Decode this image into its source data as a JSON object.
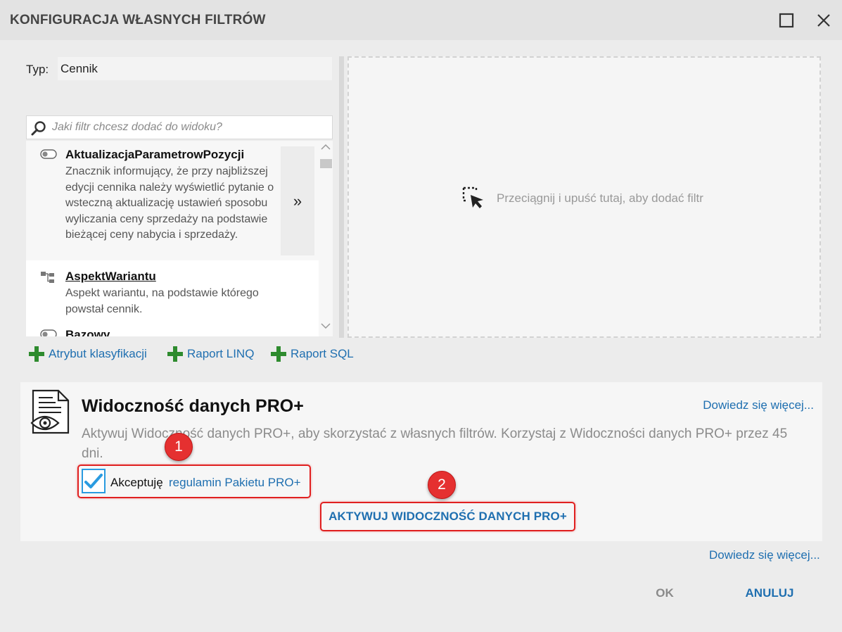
{
  "window": {
    "title": "KONFIGURACJA WŁASNYCH FILTRÓW",
    "maximize_icon": "maximize-icon",
    "close_icon": "close-icon"
  },
  "typ": {
    "label": "Typ:",
    "value": "Cennik"
  },
  "search": {
    "placeholder": "Jaki filtr chcesz dodać do widoku?",
    "icon": "search-icon"
  },
  "filters": [
    {
      "title": "AktualizacjaParametrowPozycji",
      "icon": "toggle-icon",
      "description": "Znacznik informujący, że przy najbliższej edycji cennika należy wyświetlić pytanie o wsteczną aktualizację ustawień sposobu wyliczania ceny sprzedaży na podstawie bieżącej ceny nabycia i sprzedaży.",
      "add_label": "»"
    },
    {
      "title": "AspektWariantu",
      "icon": "hierarchy-icon",
      "description": "Aspekt wariantu, na podstawie którego powstał cennik."
    },
    {
      "title": "Bazowy",
      "icon": "toggle-icon",
      "description": ""
    }
  ],
  "drop_zone": {
    "text": "Przeciągnij i upuść tutaj, aby dodać filtr",
    "icon": "drag-select-icon"
  },
  "actions": [
    {
      "label": "Atrybut klasyfikacji",
      "icon": "plus-icon"
    },
    {
      "label": "Raport LINQ",
      "icon": "plus-icon"
    },
    {
      "label": "Raport SQL",
      "icon": "plus-icon"
    }
  ],
  "pro": {
    "icon": "document-eye-icon",
    "title": "Widoczność danych PRO+",
    "learn_more": "Dowiedz się więcej...",
    "description": "Aktywuj Widoczność danych PRO+, aby skorzystać z własnych filtrów. Korzystaj z Widoczności danych PRO+ przez 45 dni.",
    "accept_label": "Akceptuję",
    "accept_link": "regulamin Pakietu PRO+",
    "accept_checked": true,
    "activate_button": "AKTYWUJ WIDOCZNOŚĆ DANYCH PRO+"
  },
  "annotations": {
    "badge1": "1",
    "badge2": "2",
    "highlight_color": "#e02020"
  },
  "footer": {
    "learn_more": "Dowiedz się więcej...",
    "ok": "OK",
    "cancel": "ANULUJ"
  },
  "colors": {
    "link": "#1f6fb0",
    "plus": "#2e8b2e",
    "checkbox_border": "#2a9be0",
    "badge": "#e53030"
  }
}
